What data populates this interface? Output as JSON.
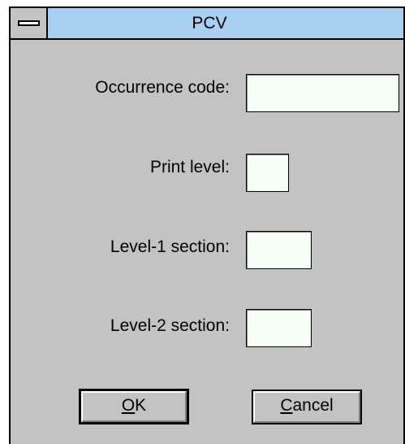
{
  "window": {
    "title": "PCV"
  },
  "fields": {
    "occurrence_code": {
      "label": "Occurrence code:",
      "value": ""
    },
    "print_level": {
      "label": "Print level:",
      "value": ""
    },
    "level1_section": {
      "label": "Level-1 section:",
      "value": ""
    },
    "level2_section": {
      "label": "Level-2 section:",
      "value": ""
    }
  },
  "buttons": {
    "ok_mnemonic": "O",
    "ok_rest": "K",
    "cancel_mnemonic": "C",
    "cancel_rest": "ancel"
  },
  "colors": {
    "titlebar": "#a8d0f0",
    "window_bg": "#c3c3c3",
    "field_bg": "#f5fff8"
  }
}
